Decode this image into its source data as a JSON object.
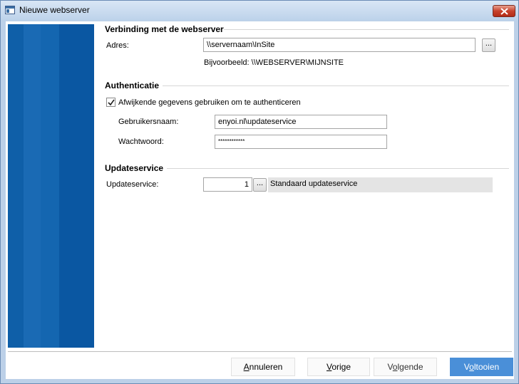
{
  "window": {
    "title": "Nieuwe webserver"
  },
  "sections": {
    "connection": {
      "title": "Verbinding met de webserver",
      "address_label": "Adres:",
      "address_value": "\\\\servernaam\\InSite",
      "browse_label": "...",
      "example_text": "Bijvoorbeeld: \\\\WEBSERVER\\MIJNSITE"
    },
    "authentication": {
      "title": "Authenticatie",
      "checkbox_label": "Afwijkende gegevens gebruiken om te authenticeren",
      "checkbox_checked": true,
      "username_label": "Gebruikersnaam:",
      "username_value": "enyoi.nl\\updateservice",
      "password_label": "Wachtwoord:",
      "password_value": "************"
    },
    "updateservice": {
      "title": "Updateservice",
      "label": "Updateservice:",
      "value": "1",
      "browse_label": "...",
      "description": "Standaard updateservice"
    }
  },
  "buttons": {
    "cancel": {
      "first": "A",
      "rest": "nnuleren"
    },
    "previous": {
      "first": "V",
      "rest": "orige"
    },
    "next": {
      "pre": "V",
      "u": "o",
      "rest": "lgende"
    },
    "finish": {
      "pre": "V",
      "u": "o",
      "rest": "ltooien"
    }
  },
  "colors": {
    "banner": "#0f5fa8",
    "primary_button": "#4a8fd8",
    "close_button": "#c7422c"
  }
}
